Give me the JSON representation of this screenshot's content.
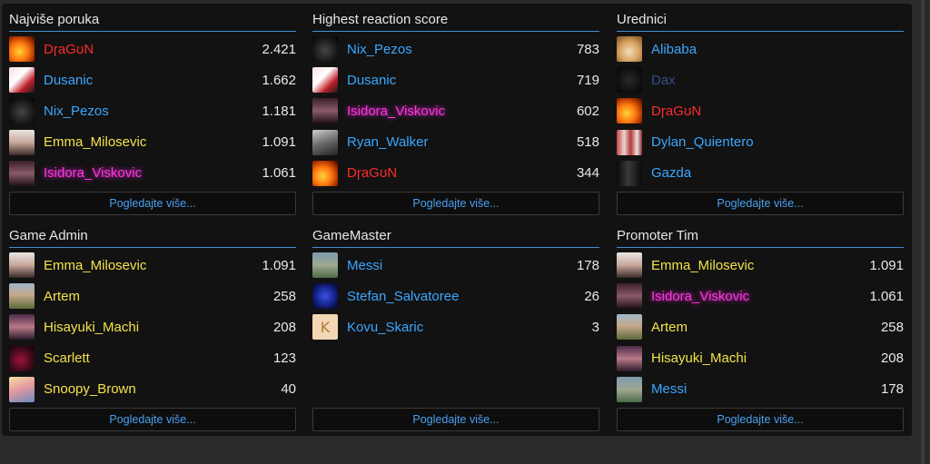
{
  "more_label": "Pogledajte više...",
  "blocks": [
    {
      "title": "Najviše poruka",
      "rows": [
        {
          "name": "DɼaGʊN",
          "count": "2.421",
          "color": "red",
          "avatar": "fire"
        },
        {
          "name": "Dusanic",
          "count": "1.662",
          "color": "blue",
          "avatar": "clown"
        },
        {
          "name": "Nix_Pezos",
          "count": "1.181",
          "color": "blue",
          "avatar": "crown-dark"
        },
        {
          "name": "Emma_Milosevic",
          "count": "1.091",
          "color": "yellow",
          "avatar": "portrait-light"
        },
        {
          "name": "Isidora_Viskovic",
          "count": "1.061",
          "color": "pink",
          "avatar": "portrait-dark"
        }
      ]
    },
    {
      "title": "Highest reaction score",
      "rows": [
        {
          "name": "Nix_Pezos",
          "count": "783",
          "color": "blue",
          "avatar": "crown-dark"
        },
        {
          "name": "Dusanic",
          "count": "719",
          "color": "blue",
          "avatar": "clown"
        },
        {
          "name": "Isidora_Viskovic",
          "count": "602",
          "color": "pink",
          "avatar": "portrait-dark"
        },
        {
          "name": "Ryan_Walker",
          "count": "518",
          "color": "blue",
          "avatar": "grey-face"
        },
        {
          "name": "DɼaGʊN",
          "count": "344",
          "color": "red",
          "avatar": "fire"
        }
      ]
    },
    {
      "title": "Urednici",
      "rows": [
        {
          "name": "Alibaba",
          "count": "",
          "color": "blue",
          "avatar": "dog"
        },
        {
          "name": "Dax",
          "count": "",
          "color": "dim",
          "avatar": "black"
        },
        {
          "name": "DɼaGʊN",
          "count": "",
          "color": "red",
          "avatar": "fire"
        },
        {
          "name": "Dylan_Quientero",
          "count": "",
          "color": "blue",
          "avatar": "collage"
        },
        {
          "name": "Gazda",
          "count": "",
          "color": "blue",
          "avatar": "dark-figure"
        }
      ]
    },
    {
      "title": "Game Admin",
      "rows": [
        {
          "name": "Emma_Milosevic",
          "count": "1.091",
          "color": "yellow",
          "avatar": "portrait-light"
        },
        {
          "name": "Artem",
          "count": "258",
          "color": "yellow",
          "avatar": "man-outdoor"
        },
        {
          "name": "Hisayuki_Machi",
          "count": "208",
          "color": "yellow",
          "avatar": "anime"
        },
        {
          "name": "Scarlett",
          "count": "123",
          "color": "yellow",
          "avatar": "dark-red"
        },
        {
          "name": "Snoopy_Brown",
          "count": "40",
          "color": "yellow",
          "avatar": "cartoon"
        }
      ]
    },
    {
      "title": "GameMaster",
      "rows": [
        {
          "name": "Messi",
          "count": "178",
          "color": "blue",
          "avatar": "football"
        },
        {
          "name": "Stefan_Salvatoree",
          "count": "26",
          "color": "blue",
          "avatar": "blue-logo"
        },
        {
          "name": "Kovu_Skaric",
          "count": "3",
          "color": "blue",
          "avatar": "letter-k"
        }
      ]
    },
    {
      "title": "Promoter Tim",
      "rows": [
        {
          "name": "Emma_Milosevic",
          "count": "1.091",
          "color": "yellow",
          "avatar": "portrait-light"
        },
        {
          "name": "Isidora_Viskovic",
          "count": "1.061",
          "color": "pink",
          "avatar": "portrait-dark"
        },
        {
          "name": "Artem",
          "count": "258",
          "color": "yellow",
          "avatar": "man-outdoor"
        },
        {
          "name": "Hisayuki_Machi",
          "count": "208",
          "color": "yellow",
          "avatar": "anime"
        },
        {
          "name": "Messi",
          "count": "178",
          "color": "blue",
          "avatar": "football"
        }
      ]
    }
  ],
  "colors": {
    "accent": "#3f8fd8",
    "red": "#ff2a2a",
    "blue": "#3aa7ff",
    "yellow": "#f3e34a",
    "pink": "#ff33e2"
  },
  "avatar_letter": "K"
}
